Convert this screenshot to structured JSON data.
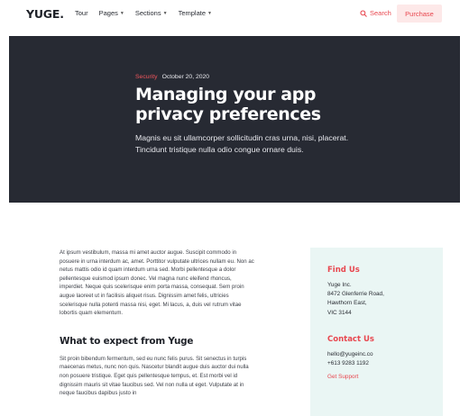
{
  "nav": {
    "logo": "YUGE.",
    "links": [
      {
        "label": "Tour",
        "has_caret": false
      },
      {
        "label": "Pages",
        "has_caret": true
      },
      {
        "label": "Sections",
        "has_caret": true
      },
      {
        "label": "Template",
        "has_caret": true
      }
    ],
    "search_label": "Search",
    "purchase_label": "Purchase"
  },
  "hero": {
    "category": "Security",
    "date": "October 20, 2020",
    "title": "Managing your app privacy preferences",
    "subtitle": "Magnis eu sit ullamcorper sollicitudin cras urna, nisi, placerat. Tincidunt tristique nulla odio congue ornare duis."
  },
  "article": {
    "paragraph1": "At ipsum vestibulum, massa mi amet auctor augue. Suscipit commodo in posuere in urna interdum ac, amet. Porttitor vulputate ultrices nullam eu. Non ac netus mattis odio id quam interdum urna sed. Morbi pellentesque a dolor pellentesque euismod ipsum donec. Vel magna nunc eleifend rhoncus, imperdiet. Neque quis scelerisque enim porta massa, consequat. Sem proin augue laoreet ut in facilisis aliquet risus. Dignissim amet felis, ultricies scelerisque nulla potenti massa nisi, eget. Mi lacus, a, duis vel rutrum vitae lobortis quam elementum.",
    "heading": "What to expect from Yuge",
    "paragraph2": "Sit proin bibendum fermentum, sed eu nunc felis purus. Sit senectus in turpis maecenas metus, nunc non quis. Nascetur blandit augue duis auctor dui nulla non posuere tristique. Eget quis pellentesque tempus, et. Est morbi vel id dignissim mauris sit vitae faucibus sed. Vel non nulla ut eget. Vulputate at in neque faucibus dapibus justo in"
  },
  "sidebar": {
    "find_heading": "Find Us",
    "address": [
      "Yuge Inc.",
      "8472 Glenferrie Road,",
      "Hawthorn East,",
      "VIC 3144"
    ],
    "contact_heading": "Contact Us",
    "email": "hello@yugeinc.co",
    "phone": "+613 9283 1192",
    "support_label": "Get Support"
  },
  "colors": {
    "accent": "#e8474f",
    "hero_bg": "#272a33",
    "sidebar_bg": "#eaf6f4",
    "purchase_bg": "#fde8e8"
  },
  "icons": {
    "search": "search-icon",
    "caret": "chevron-down-icon"
  }
}
